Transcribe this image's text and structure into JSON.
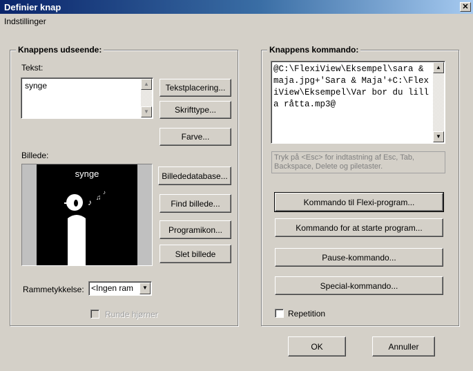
{
  "window": {
    "title": "Definier knap",
    "close_glyph": "✕"
  },
  "menu": {
    "items": [
      "Indstillinger"
    ]
  },
  "appearance": {
    "group_title": "Knappens udseende:",
    "text_label": "Tekst:",
    "text_value": "synge",
    "buttons": {
      "text_placement": "Tekstplacering...",
      "font": "Skrifttype...",
      "color": "Farve..."
    },
    "image_label": "Billede:",
    "image_caption": "synge",
    "image_buttons": {
      "database": "Billededatabase...",
      "find": "Find billede...",
      "program_icon": "Programikon...",
      "delete": "Slet billede"
    },
    "frame_label": "Rammetykkelse:",
    "frame_value": "<Ingen ram",
    "rounded_corners_label": "Runde hjørner",
    "rounded_corners_checked": false
  },
  "command": {
    "group_title": "Knappens kommando:",
    "command_text": "@C:\\FlexiView\\Eksempel\\sara & maja.jpg+'Sara & Maja'+C:\\FlexiView\\Eksempel\\Var bor du lilla råtta.mp3@",
    "hint_text": "Tryk på <Esc> for indtastning af Esc, Tab, Backspace, Delete og piletaster.",
    "buttons": {
      "flexi": "Kommando til Flexi-program...",
      "start": "Kommando for at starte program...",
      "pause": "Pause-kommando...",
      "special": "Special-kommando..."
    },
    "repetition_label": "Repetition",
    "repetition_checked": false
  },
  "footer": {
    "ok": "OK",
    "cancel": "Annuller"
  },
  "colors": {
    "face": "#d4d0c8",
    "title_start": "#0a246a",
    "title_end": "#a6caf0",
    "image_bg": "#000000"
  }
}
